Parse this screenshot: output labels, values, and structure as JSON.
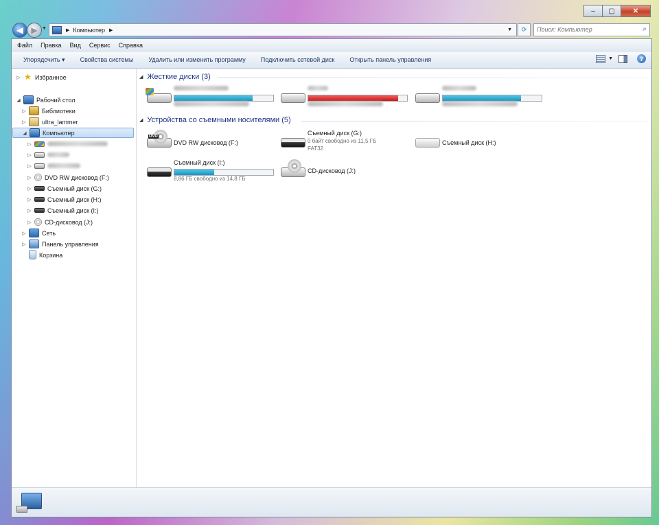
{
  "window": {
    "caption": {
      "minimize": "–",
      "maximize": "▢",
      "close": "✕"
    }
  },
  "nav": {
    "back_icon": "◀",
    "address_crumb": "Компьютер",
    "search_placeholder": "Поиск: Компьютер"
  },
  "menu": [
    "Файл",
    "Правка",
    "Вид",
    "Сервис",
    "Справка"
  ],
  "toolbar": [
    "Упорядочить ▾",
    "Свойства системы",
    "Удалить или изменить программу",
    "Подключить сетевой диск",
    "Открыть панель управления"
  ],
  "tree": {
    "favorites": "Избранное",
    "desktop": "Рабочий стол",
    "libraries": "Библиотеки",
    "user": "ultra_lammer",
    "computer": "Компьютер",
    "dvd": "DVD RW дисковод (F:)",
    "g": "Съемный диск (G:)",
    "h": "Съемный диск (H:)",
    "i": "Съемный диск (I:)",
    "cd": "CD-дисковод (J:)",
    "network": "Сеть",
    "control": "Панель управления",
    "bin": "Корзина"
  },
  "groups": {
    "hdd": "Жесткие диски (3)",
    "removable": "Устройства со съемными носителями (5)"
  },
  "hdd_fill": [
    0.79,
    0.91,
    0.79
  ],
  "removable": {
    "f": {
      "name": "DVD RW дисковод (F:)"
    },
    "g": {
      "name": "Съемный диск (G:)",
      "free": "0 байт свободно из 11,5 ГБ",
      "fs": "FAT32"
    },
    "h": {
      "name": "Съемный диск (H:)"
    },
    "i": {
      "name": "Съемный диск (I:)",
      "free": "8,86 ГБ свободно из 14,8 ГБ",
      "fill": 0.4
    },
    "j": {
      "name": "CD-дисковод (J:)"
    }
  }
}
